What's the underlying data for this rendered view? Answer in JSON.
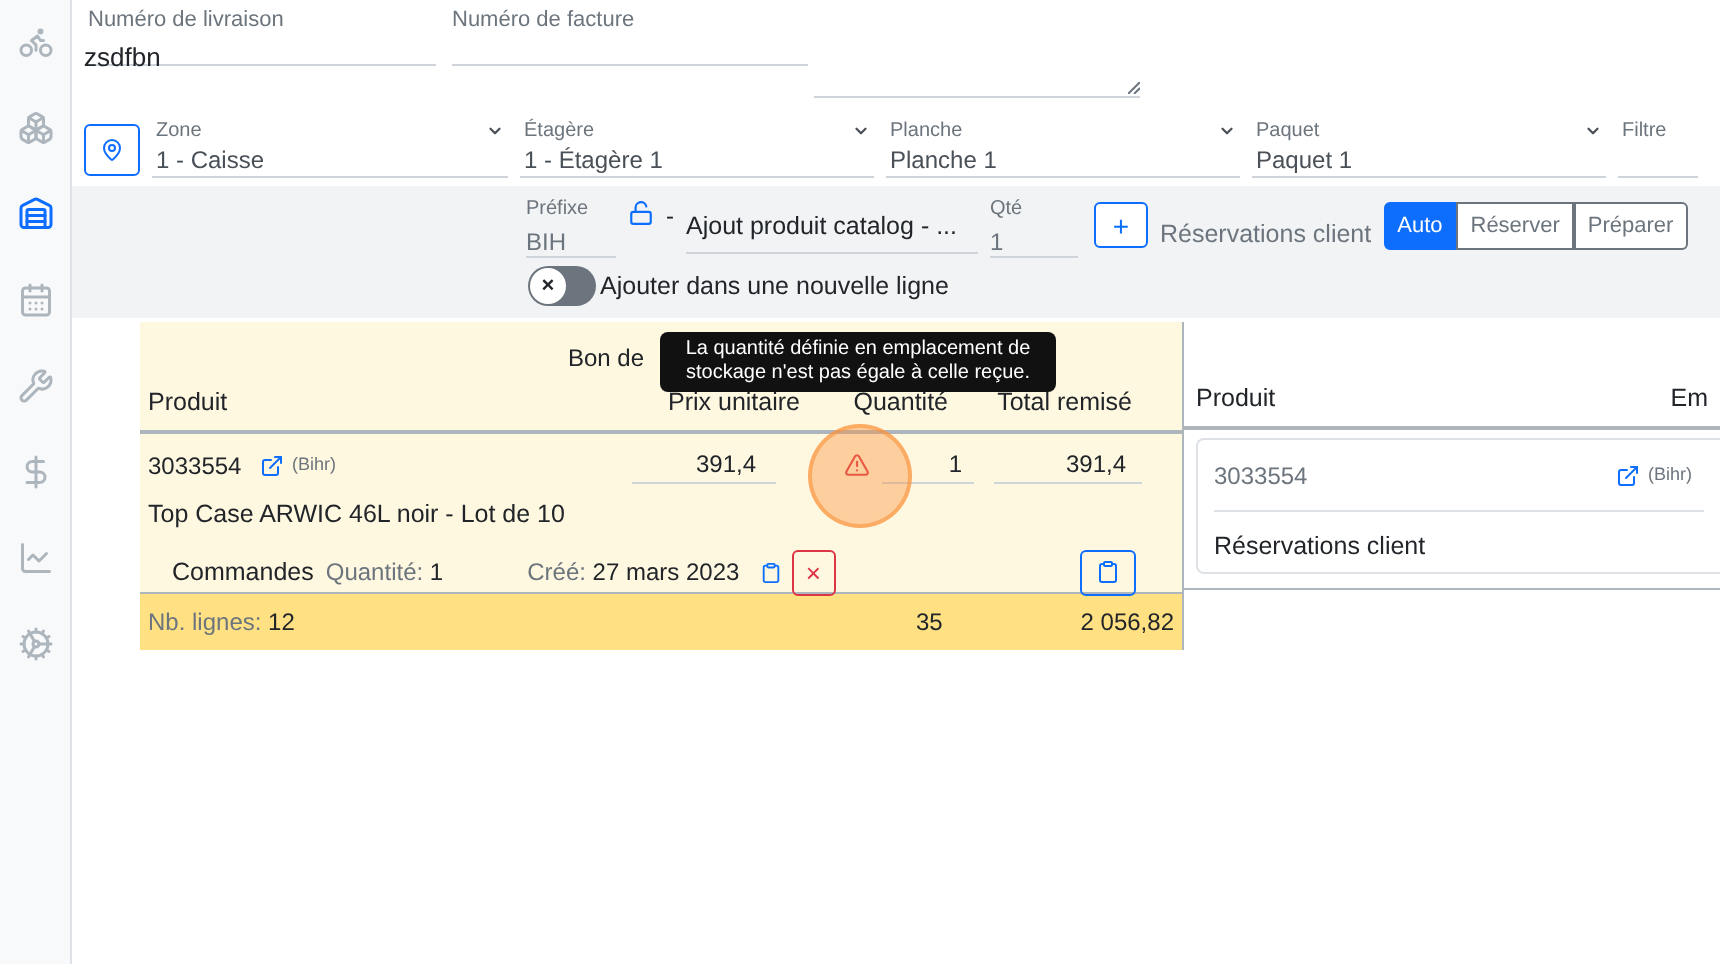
{
  "sidebar": {
    "items": [
      {
        "selected": false
      },
      {
        "selected": false
      },
      {
        "selected": true
      },
      {
        "selected": false
      },
      {
        "selected": false
      },
      {
        "selected": false
      },
      {
        "selected": false
      },
      {
        "selected": false
      }
    ]
  },
  "delivery_number": {
    "label": "Numéro de livraison",
    "value": "zsdfbn"
  },
  "invoice_number": {
    "label": "Numéro de facture"
  },
  "location": [
    {
      "label": "Zone",
      "value": "1 - Caisse",
      "kind": "select"
    },
    {
      "label": "Étagère",
      "value": "1 - Étagère 1",
      "kind": "select"
    },
    {
      "label": "Planche",
      "value": "Planche 1",
      "kind": "select"
    },
    {
      "label": "Paquet",
      "value": "Paquet 1",
      "kind": "select"
    },
    {
      "label": "Filtre",
      "kind": "text"
    }
  ],
  "add_bar": {
    "prefix_label": "Préfixe",
    "prefix": "BIH",
    "locked": false,
    "dash": "-",
    "product": "Ajout produit catalog - ...",
    "qty_label": "Qté",
    "qty": "1",
    "plus": "+",
    "reservations_label": "Réservations client",
    "modes": [
      {
        "label": "Auto",
        "selected": true
      },
      {
        "label": "Réserver",
        "selected": false
      },
      {
        "label": "Préparer",
        "selected": false
      }
    ],
    "new_line": {
      "label": "Ajouter dans une nouvelle ligne",
      "on": false,
      "knob": "×"
    }
  },
  "delivery_table": {
    "title": "Bon de",
    "columns": [
      "Produit",
      "Prix unitaire",
      "Quantité",
      "Total remisé"
    ],
    "rows": [
      {
        "sku": "3033554",
        "supplier": "(Bihr)",
        "name": "Top Case ARWIC 46L noir - Lot de 10",
        "unit_price": "391,4",
        "quantity": "1",
        "total": "391,4",
        "orders": "Commandes",
        "qty_label": "Quantité:",
        "qty": "1",
        "created_label": "Créé:",
        "created": "27 mars 2023",
        "remove": "×"
      }
    ],
    "footer": {
      "label": "Nb. lignes:",
      "count": "12",
      "quantity": "35",
      "total": "2 056,82"
    }
  },
  "tooltip": "La quantité définie en emplacement de stockage n'est pas égale à celle reçue.",
  "reservation_table": {
    "columns": [
      "Produit",
      "Em"
    ],
    "rows": [
      {
        "sku": "3033554",
        "supplier": "(Bihr)",
        "label": "Réservations client"
      }
    ]
  }
}
